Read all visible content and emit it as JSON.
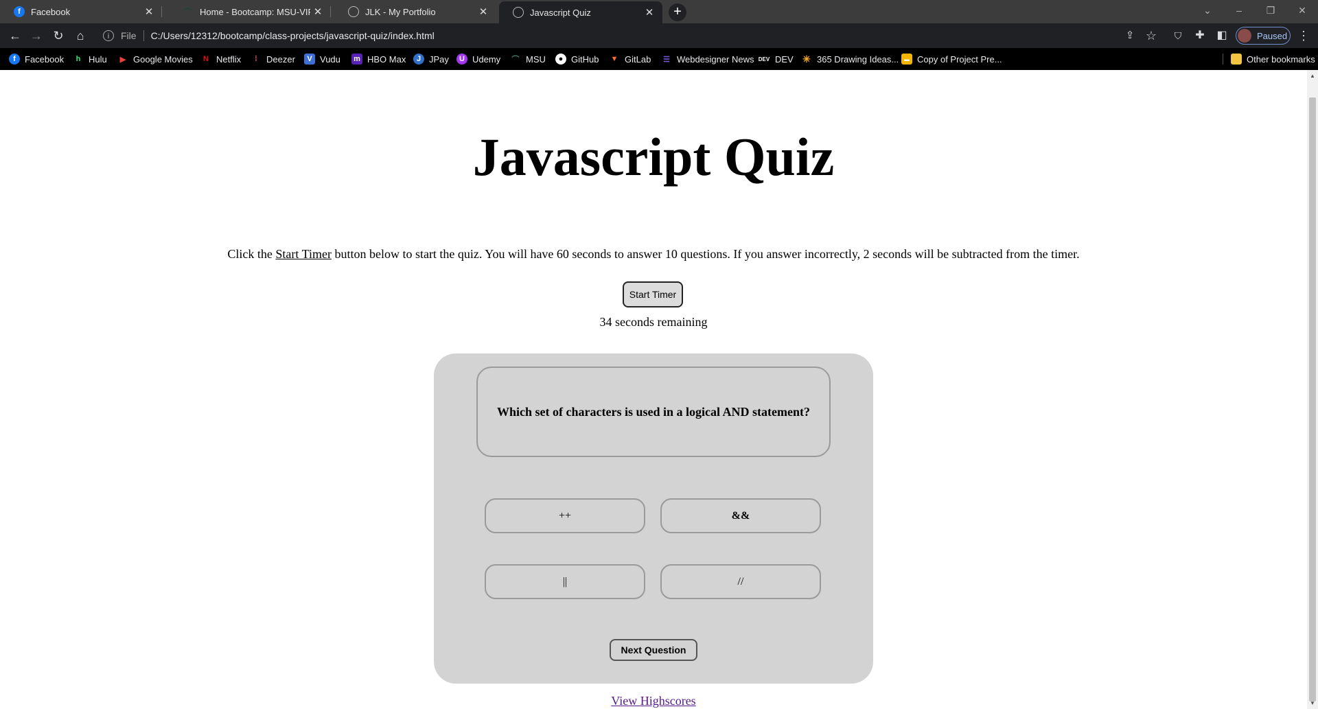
{
  "browser": {
    "tabs": [
      {
        "title": "Facebook",
        "icon": "facebook-icon",
        "color": "#1877f2",
        "glyph": "f"
      },
      {
        "title": "Home - Bootcamp: MSU-VIRT-FS",
        "icon": "msu-icon",
        "color": "#18453b",
        "glyph": "⌒"
      },
      {
        "title": "JLK - My Portfolio",
        "icon": "globe-icon",
        "color": "#6b6b6b",
        "glyph": "◍"
      },
      {
        "title": "Javascript Quiz",
        "icon": "globe-icon",
        "color": "#6b6b6b",
        "glyph": "◍"
      }
    ],
    "address": {
      "scheme_label": "File",
      "url": "C:/Users/12312/bootcamp/class-projects/javascript-quiz/index.html"
    },
    "profile_label": "Paused",
    "bookmarks": [
      {
        "label": "Facebook",
        "icon": "facebook-icon",
        "color": "#1877f2",
        "glyph": "f"
      },
      {
        "label": "Hulu",
        "icon": "hulu-icon",
        "color": "#1ce783",
        "glyph": "h"
      },
      {
        "label": "Google Movies",
        "icon": "google-play-icon",
        "color": "#ea4335",
        "glyph": "▶"
      },
      {
        "label": "Netflix",
        "icon": "netflix-icon",
        "color": "#e50914",
        "glyph": "N"
      },
      {
        "label": "Deezer",
        "icon": "deezer-icon",
        "color": "#ef5466",
        "glyph": "⁞"
      },
      {
        "label": "Vudu",
        "icon": "vudu-icon",
        "color": "#3d6fd6",
        "glyph": "V"
      },
      {
        "label": "HBO Max",
        "icon": "hbo-max-icon",
        "color": "#5822b4",
        "glyph": "m"
      },
      {
        "label": "JPay",
        "icon": "jpay-icon",
        "color": "#2f6fc8",
        "glyph": "J"
      },
      {
        "label": "Udemy",
        "icon": "udemy-icon",
        "color": "#a435f0",
        "glyph": "U"
      },
      {
        "label": "MSU",
        "icon": "msu-icon",
        "color": "#18453b",
        "glyph": "⌒"
      },
      {
        "label": "GitHub",
        "icon": "github-icon",
        "color": "#ffffff",
        "glyph": "●"
      },
      {
        "label": "GitLab",
        "icon": "gitlab-icon",
        "color": "#fc6d26",
        "glyph": "▼"
      },
      {
        "label": "Webdesigner News",
        "icon": "webdesigner-news-icon",
        "color": "#7b5cd6",
        "glyph": "☰"
      },
      {
        "label": "DEV",
        "icon": "dev-icon",
        "color": "#ffffff",
        "glyph": "DEV"
      },
      {
        "label": "365 Drawing Ideas...",
        "icon": "star-icon",
        "color": "#f5a623",
        "glyph": "✳"
      },
      {
        "label": "Copy of Project Pre...",
        "icon": "slides-icon",
        "color": "#f4b400",
        "glyph": "▬"
      }
    ],
    "other_bookmarks": "Other bookmarks"
  },
  "quiz": {
    "title": "Javascript Quiz",
    "instructions_before": "Click the ",
    "instructions_link": "Start Timer",
    "instructions_after": " button below to start the quiz. You will have 60 seconds to answer 10 questions. If you answer incorrectly, 2 seconds will be subtracted from the timer.",
    "start_button": "Start Timer",
    "timer_text": "34 seconds remaining",
    "question": "Which set of characters is used in a logical AND statement?",
    "answers": [
      "++",
      "&&",
      "||",
      "//"
    ],
    "next_button": "Next Question",
    "highscores_link": "View Highscores"
  }
}
